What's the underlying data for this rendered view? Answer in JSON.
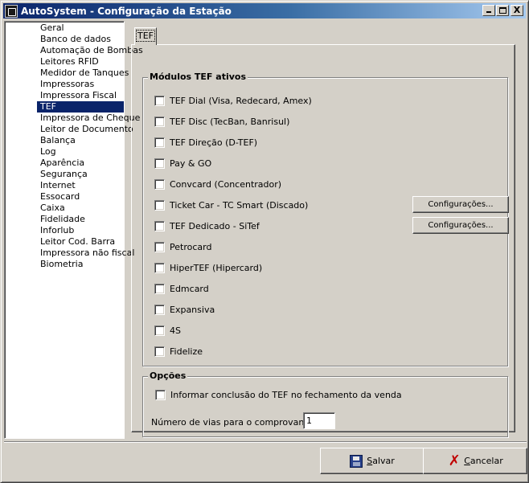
{
  "window": {
    "title": "AutoSystem - Configuração da Estação",
    "controls": {
      "minimize": "_",
      "maximize": "□",
      "close": "X"
    }
  },
  "sidebar": {
    "items": [
      {
        "label": "Geral"
      },
      {
        "label": "Banco de dados"
      },
      {
        "label": "Automação de Bombas"
      },
      {
        "label": "Leitores RFID"
      },
      {
        "label": "Medidor de Tanques"
      },
      {
        "label": "Impressoras"
      },
      {
        "label": "Impressora Fiscal"
      },
      {
        "label": "TEF"
      },
      {
        "label": "Impressora de Cheque"
      },
      {
        "label": "Leitor de Documento"
      },
      {
        "label": "Balança"
      },
      {
        "label": "Log"
      },
      {
        "label": "Aparência"
      },
      {
        "label": "Segurança"
      },
      {
        "label": "Internet"
      },
      {
        "label": "Essocard"
      },
      {
        "label": "Caixa"
      },
      {
        "label": "Fidelidade"
      },
      {
        "label": "Inforlub"
      },
      {
        "label": "Leitor Cod. Barra"
      },
      {
        "label": "Impressora não fiscal"
      },
      {
        "label": "Biometria"
      }
    ],
    "selected_index": 7,
    "selection_color": "#0a246a"
  },
  "tabs": [
    {
      "label": "TEF",
      "active": true
    }
  ],
  "modules": {
    "title": "Módulos TEF ativos",
    "items": [
      {
        "label": "TEF Dial (Visa, Redecard, Amex)",
        "checked": false
      },
      {
        "label": "TEF Disc (TecBan, Banrisul)",
        "checked": false
      },
      {
        "label": "TEF Direção (D-TEF)",
        "checked": false
      },
      {
        "label": "Pay & GO",
        "checked": false
      },
      {
        "label": "Convcard (Concentrador)",
        "checked": false
      },
      {
        "label": "Ticket Car - TC Smart (Discado)",
        "checked": false,
        "config_button": "Configurações..."
      },
      {
        "label": "TEF Dedicado - SiTef",
        "checked": false,
        "config_button": "Configurações..."
      },
      {
        "label": "Petrocard",
        "checked": false
      },
      {
        "label": "HiperTEF (Hipercard)",
        "checked": false
      },
      {
        "label": "Edmcard",
        "checked": false
      },
      {
        "label": "Expansiva",
        "checked": false
      },
      {
        "label": "4S",
        "checked": false
      },
      {
        "label": "Fidelize",
        "checked": false
      }
    ]
  },
  "options": {
    "title": "Opções",
    "inform_conclusion": {
      "label": "Informar conclusão do TEF no fechamento da venda",
      "checked": false
    },
    "vias": {
      "label": "Número de vias para o comprovante:",
      "value": "1"
    }
  },
  "footer": {
    "save": {
      "label_hotkey": "S",
      "label_rest": "alvar"
    },
    "cancel": {
      "label_hotkey": "C",
      "label_rest": "ancelar"
    }
  },
  "colors": {
    "title_gradient_start": "#0a246a",
    "title_gradient_end": "#a6caf0",
    "face": "#d4d0c8",
    "cancel_icon": "#c00000"
  }
}
